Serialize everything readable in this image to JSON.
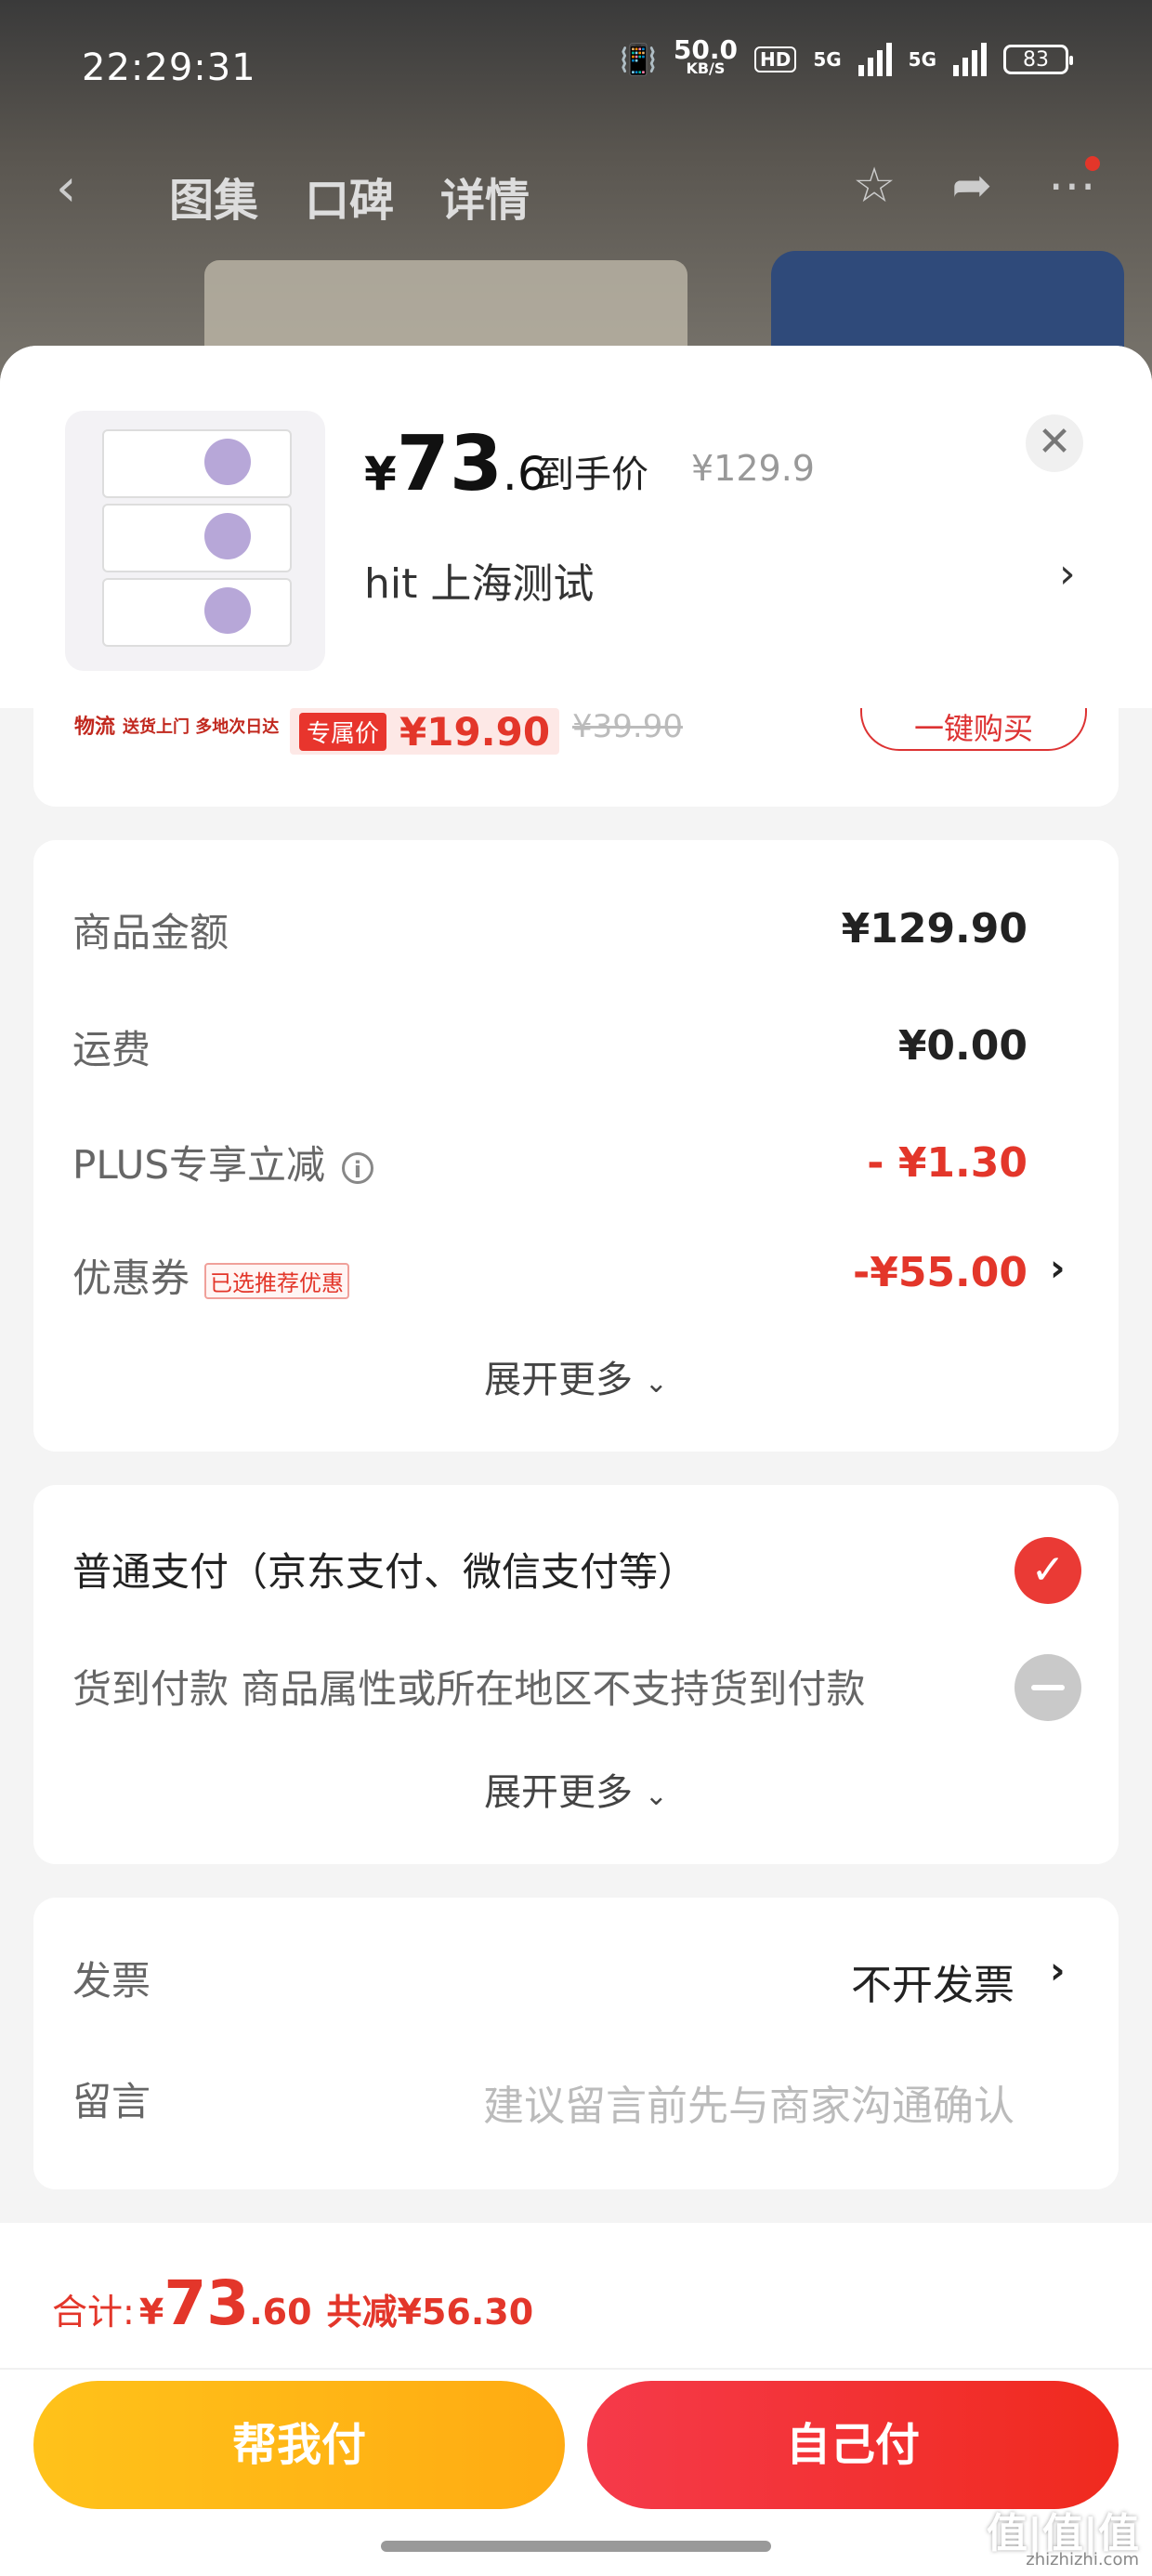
{
  "status_bar": {
    "time": "22:29:31",
    "net_speed_value": "50.0",
    "net_speed_unit": "KB/S",
    "hd_label": "HD",
    "sim1_label": "5G",
    "sim2_label": "5G",
    "battery": "83"
  },
  "nav": {
    "tabs": [
      "图集",
      "口碑",
      "详情"
    ]
  },
  "product": {
    "price_currency": "¥",
    "price_int": "73",
    "price_dec": ".6",
    "price_label": "到手价",
    "original_price": "¥129.9",
    "spec": "hit  上海测试"
  },
  "promo_strip": {
    "logistics": "物流",
    "logistics_sub": "送货上门 多地次日达",
    "tag": "专属价",
    "tag_price": "¥19.90",
    "strike_price": "¥39.90",
    "buy_label": "一键购买"
  },
  "summary": {
    "goods_amount_label": "商品金额",
    "goods_amount": "¥129.90",
    "shipping_label": "运费",
    "shipping": "¥0.00",
    "plus_label": "PLUS专享立减",
    "plus_discount": "- ¥1.30",
    "coupon_label": "优惠券",
    "coupon_tag": "已选推荐优惠",
    "coupon_discount": "-¥55.00",
    "expand_label": "展开更多"
  },
  "payment": {
    "normal": "普通支付（京东支付、微信支付等）",
    "cod": "货到付款 商品属性或所在地区不支持货到付款",
    "expand_label": "展开更多"
  },
  "extra": {
    "invoice_label": "发票",
    "invoice_value": "不开发票",
    "note_label": "留言",
    "note_placeholder": "建议留言前先与商家沟通确认"
  },
  "footer": {
    "total_label": "合计:",
    "total_currency": "¥",
    "total_int": "73",
    "total_dec": ".60",
    "total_saving": "共减¥56.30",
    "help_pay_label": "帮我付",
    "self_pay_label": "自己付"
  },
  "watermark": {
    "text": "值|值|值",
    "site": "zhizhizhi.com"
  }
}
